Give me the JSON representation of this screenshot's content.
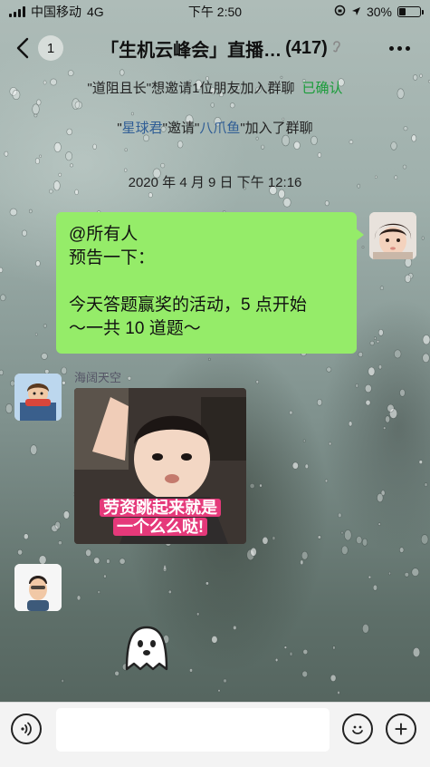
{
  "status_bar": {
    "carrier": "中国移动",
    "network": "4G",
    "time": "下午 2:50",
    "battery": "30%",
    "battery_level": 0.3
  },
  "nav": {
    "back_glyph": "〈",
    "unread_count": "1",
    "title": "「生机云峰会」直播…",
    "member_count": "(417)",
    "mute_icon": "ear-mute-icon"
  },
  "system_messages": {
    "invite_request": {
      "prefix": "\"道阻且长\"想邀请1位朋友加入群聊",
      "action": "已确认"
    },
    "join_notice": {
      "q1": "\"",
      "inviter": "星球君",
      "middle": "\"邀请\"",
      "invitee": "八爪鱼",
      "suffix": "\"加入了群聊"
    },
    "timestamp": "2020 年 4 月 9 日  下午 12:16"
  },
  "messages": [
    {
      "type": "text",
      "from_self": true,
      "lines": [
        "@所有人",
        "预告一下：",
        "",
        "今天答题赢奖的活动，5 点开始",
        "～一共 10 道题～"
      ]
    },
    {
      "type": "image",
      "from_self": false,
      "sender": "海阔天空",
      "caption_line1": "劳资跳起来就是",
      "caption_line2": "一个么么哒!"
    },
    {
      "type": "sticker",
      "from_self": false,
      "sticker": "ghost-sticker"
    }
  ],
  "input_bar": {
    "voice_icon": "voice-icon",
    "emoji_icon": "emoji-icon",
    "plus_icon": "plus-icon",
    "plus_glyph": "+"
  },
  "colors": {
    "bubble_self": "#95ec69",
    "link": "#2f5d95",
    "confirm": "#1a9c3a"
  }
}
